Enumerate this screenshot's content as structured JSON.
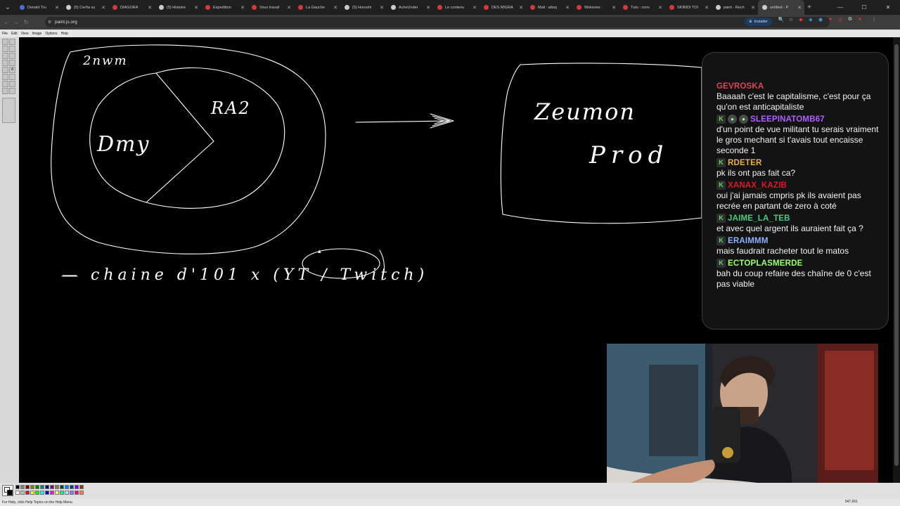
{
  "browser": {
    "tabs": [
      {
        "label": "Donald Tru",
        "favicon_color": "#4a6cd4"
      },
      {
        "label": "(5) Cerfia su",
        "favicon_color": "#cccccc"
      },
      {
        "label": "DIAGORA",
        "favicon_color": "#d43a3a"
      },
      {
        "label": "(5) Histoire",
        "favicon_color": "#cccccc"
      },
      {
        "label": "Expedition",
        "favicon_color": "#d43a3a"
      },
      {
        "label": "Vous travail",
        "favicon_color": "#d43a3a"
      },
      {
        "label": "La Gauche",
        "favicon_color": "#d43a3a"
      },
      {
        "label": "(5) Horoshi",
        "favicon_color": "#cccccc"
      },
      {
        "label": "AcheUnder",
        "favicon_color": "#cccccc"
      },
      {
        "label": "Le contenu",
        "favicon_color": "#d43a3a"
      },
      {
        "label": "DES MIGRA",
        "favicon_color": "#d43a3a"
      },
      {
        "label": "Mali : attaq",
        "favicon_color": "#d43a3a"
      },
      {
        "label": "Wokisme :",
        "favicon_color": "#d43a3a"
      },
      {
        "label": "Tuto : conv",
        "favicon_color": "#d43a3a"
      },
      {
        "label": "SKIBIDI TOI",
        "favicon_color": "#d43a3a"
      },
      {
        "label": "paint - Rech",
        "favicon_color": "#cccccc"
      },
      {
        "label": "untitled - P",
        "favicon_color": "#cccccc",
        "active": true
      }
    ],
    "url": "paint.js.org",
    "install_label": "Installer"
  },
  "paint": {
    "menu": [
      "File",
      "Edit",
      "View",
      "Image",
      "Options",
      "Help"
    ],
    "status_text": "For Help, click Help Topics on the Help Menu.",
    "coords": "947,661",
    "palette_colors": [
      "#000000",
      "#808080",
      "#800000",
      "#808000",
      "#008000",
      "#008080",
      "#000080",
      "#800080",
      "#808040",
      "#004040",
      "#0080ff",
      "#004080",
      "#8000ff",
      "#804000",
      "#ffffff",
      "#c0c0c0",
      "#ff0000",
      "#ffff00",
      "#00ff00",
      "#00ffff",
      "#0000ff",
      "#ff00ff",
      "#ffff80",
      "#00ff80",
      "#80ffff",
      "#8080ff",
      "#ff0080",
      "#ff8040"
    ]
  },
  "drawing": {
    "left_outer_label": "2nwm",
    "inner_left_label": "Dmy",
    "inner_right_label": "RA2",
    "right_line1": "Zeumon",
    "right_line2": "Prod",
    "bottom_text": "— chaine d'101 x (YT / Twitch)"
  },
  "chat": {
    "messages": [
      {
        "user": "GEVROSKA",
        "color": "#e0405a",
        "badges": [],
        "text": "Baaaah c'est le capitalisme, c'est pour ça qu'on est anticapitaliste"
      },
      {
        "user": "SLEEPINATOMB67",
        "color": "#b060ff",
        "badges": [
          "K",
          "s",
          "s"
        ],
        "text": "d'un point de vue militant tu serais vraiment le gros mechant si t'avais tout encaisse seconde 1"
      },
      {
        "user": "RDETER",
        "color": "#e8b04a",
        "badges": [
          "K"
        ],
        "text": "pk ils ont pas fait ca?"
      },
      {
        "user": "XANAX_KAZIB",
        "color": "#e0142a",
        "badges": [
          "K"
        ],
        "text": "oui j'ai jamais cmpris pk ils avaient pas recrée en partant de zero à coté"
      },
      {
        "user": "JAIME_LA_TEB",
        "color": "#40d080",
        "badges": [
          "K"
        ],
        "text": "et avec quel argent ils auraient fait ça ?"
      },
      {
        "user": "ERAIMMM",
        "color": "#8fb0ff",
        "badges": [
          "K"
        ],
        "text": "mais faudrait racheter tout le matos"
      },
      {
        "user": "ECTOPLASMERDE",
        "color": "#9cff6e",
        "badges": [
          "K"
        ],
        "text": "bah du coup refaire des chaîne de 0 c'est pas viable"
      }
    ]
  }
}
